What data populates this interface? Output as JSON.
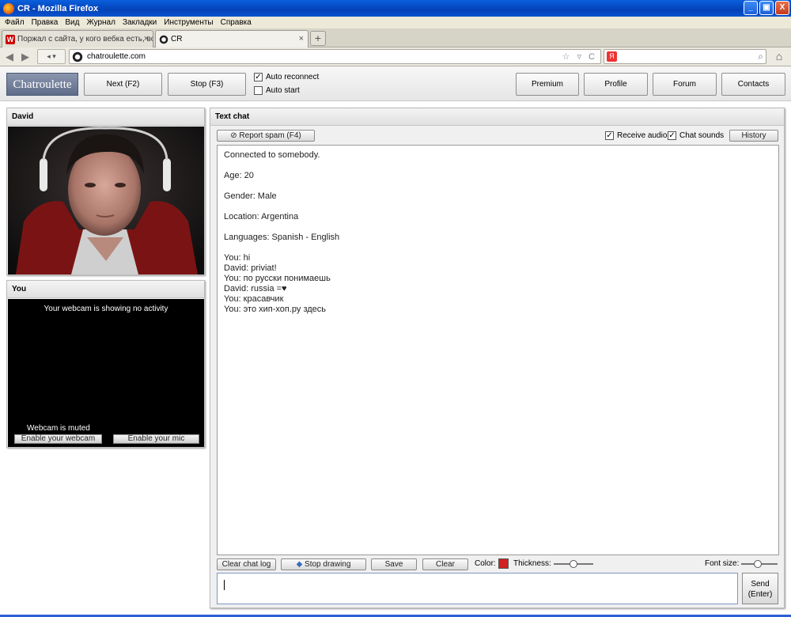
{
  "window": {
    "title": "CR - Mozilla Firefox",
    "minimize": "_",
    "maximize": "▣",
    "close": "X"
  },
  "menu": [
    "Файл",
    "Правка",
    "Вид",
    "Журнал",
    "Закладки",
    "Инструменты",
    "Справка"
  ],
  "tabs": [
    {
      "label": "Поржал с сайта, у кого вебка есть, вс...",
      "close": "×"
    },
    {
      "label": "CR",
      "close": "×"
    }
  ],
  "newtab": "+",
  "nav": {
    "url": "chatroulette.com",
    "url_icons": "☆ ▿ C",
    "search_value": "",
    "home": "⌂"
  },
  "app": {
    "logo": "Chatroulette",
    "next": "Next (F2)",
    "stop": "Stop (F3)",
    "auto_reconnect": "Auto reconnect",
    "auto_reconnect_checked": true,
    "auto_start": "Auto start",
    "auto_start_checked": false,
    "premium": "Premium",
    "profile": "Profile",
    "forum": "Forum",
    "contacts": "Contacts"
  },
  "partner": {
    "name": "David"
  },
  "self": {
    "title": "You",
    "no_activity": "Your webcam is showing no activity",
    "muted": "Webcam is muted",
    "enable_webcam": "Enable your webcam",
    "enable_mic": "Enable your mic"
  },
  "chat": {
    "title": "Text chat",
    "report_spam": "Report spam (F4)",
    "receive_audio": "Receive audio",
    "chat_sounds": "Chat sounds",
    "history": "History",
    "messages": [
      "Connected to somebody.",
      "",
      "Age: 20",
      "",
      "Gender: Male",
      "",
      "Location: Argentina",
      "",
      "Languages: Spanish - English",
      "",
      "You: hi",
      "David: priviat!",
      "You: по русски понимаешь",
      "David: russia =♥",
      "You: красавчик",
      "You: это хип-хоп.ру здесь"
    ],
    "clear_log": "Clear chat log",
    "stop_drawing": "Stop drawing",
    "save": "Save",
    "clear": "Clear",
    "color_label": "Color:",
    "color_value": "#d22020",
    "thickness_label": "Thickness:",
    "font_size_label": "Font size:",
    "send": "Send",
    "send_hint": "(Enter)",
    "input_value": ""
  }
}
